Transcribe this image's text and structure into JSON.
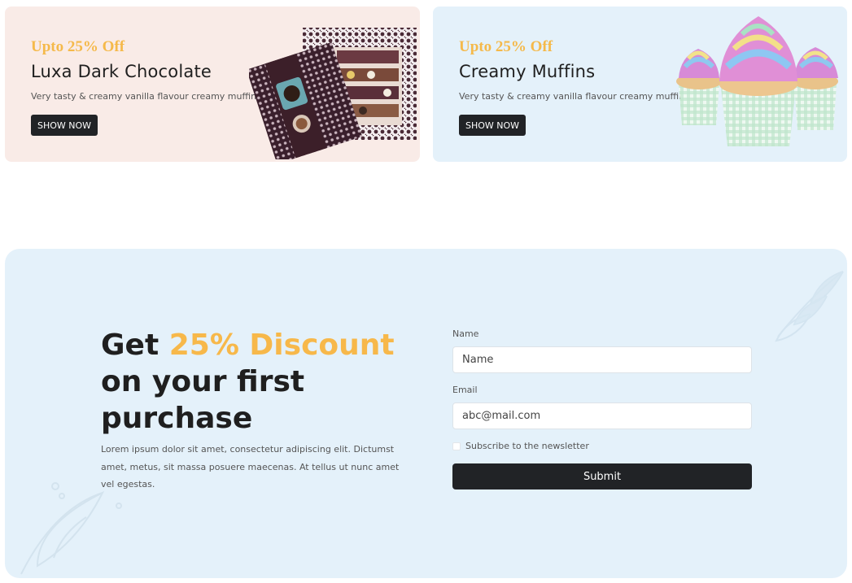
{
  "promos": [
    {
      "kicker": "Upto 25% Off",
      "title": "Luxa Dark Chocolate",
      "description": "Very tasty & creamy vanilla flavour creamy muffins.",
      "button_label": "SHOW NOW"
    },
    {
      "kicker": "Upto 25% Off",
      "title": "Creamy Muffins",
      "description": "Very tasty & creamy vanilla flavour creamy muffins.",
      "button_label": "SHOW NOW"
    }
  ],
  "discount": {
    "headline_prefix": "Get ",
    "headline_accent": "25% Discount",
    "headline_suffix": "on your first purchase",
    "body": "Lorem ipsum dolor sit amet, consectetur adipiscing elit. Dictumst amet, metus, sit massa posuere maecenas. At tellus ut nunc amet vel egestas."
  },
  "form": {
    "name_label": "Name",
    "name_placeholder": "Name",
    "email_label": "Email",
    "email_placeholder": "abc@mail.com",
    "subscribe_label": "Subscribe to the newsletter",
    "submit_label": "Submit"
  },
  "icons": [
    "chocolate-box-image",
    "cupcakes-image",
    "leaf-decoration-icon"
  ],
  "colors": {
    "accent": "#f7b84a",
    "dark": "#212326",
    "promo_pink": "#f9ebe7",
    "promo_blue": "#e4f1fa"
  }
}
